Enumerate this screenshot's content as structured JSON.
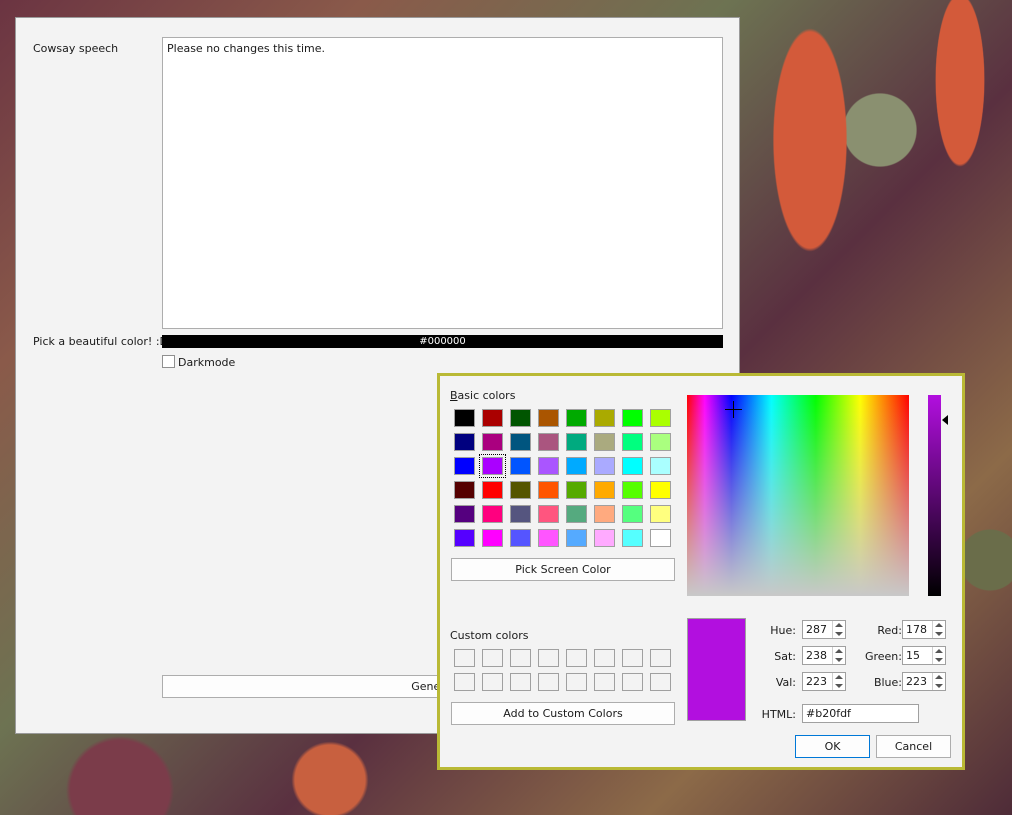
{
  "main": {
    "cowsay_label": "Cowsay speech",
    "speech_text": "Please no changes this time.",
    "color_label": "Pick a beautiful color! :D",
    "color_value": "#000000",
    "darkmode_label": "Darkmode",
    "generate_label": "Generate C"
  },
  "dialog": {
    "basic_colors_title": "Basic colors",
    "basic_colors": [
      [
        "#000000",
        "#aa0000",
        "#005500",
        "#aa5500",
        "#00aa00",
        "#aaaa00",
        "#00ff00",
        "#aaff00"
      ],
      [
        "#00007f",
        "#aa007f",
        "#00557f",
        "#aa557f",
        "#00aa7f",
        "#aaaa7f",
        "#00ff7f",
        "#aaff7f"
      ],
      [
        "#0000ff",
        "#aa00ff",
        "#0055ff",
        "#aa55ff",
        "#00aaff",
        "#aaaaff",
        "#00ffff",
        "#aaffff"
      ],
      [
        "#550000",
        "#ff0000",
        "#555500",
        "#ff5500",
        "#55aa00",
        "#ffaa00",
        "#55ff00",
        "#ffff00"
      ],
      [
        "#55007f",
        "#ff007f",
        "#55557f",
        "#ff557f",
        "#55aa7f",
        "#ffaa7f",
        "#55ff7f",
        "#ffff7f"
      ],
      [
        "#5500ff",
        "#ff00ff",
        "#5555ff",
        "#ff55ff",
        "#55aaff",
        "#ffaaff",
        "#55ffff",
        "#ffffff"
      ]
    ],
    "pick_screen_label": "Pick Screen Color",
    "custom_colors_title": "Custom colors",
    "add_custom_label": "Add to Custom Colors",
    "hue_label": "Hue:",
    "hue": "287",
    "sat_label": "Sat:",
    "sat": "238",
    "val_label": "Val:",
    "val": "223",
    "red_label": "Red:",
    "red": "178",
    "green_label": "Green:",
    "green": "15",
    "blue_label": "Blue:",
    "blue": "223",
    "html_label": "HTML:",
    "html_value": "#b20fdf",
    "ok_label": "OK",
    "cancel_label": "Cancel",
    "current_color": "#b20fdf"
  }
}
